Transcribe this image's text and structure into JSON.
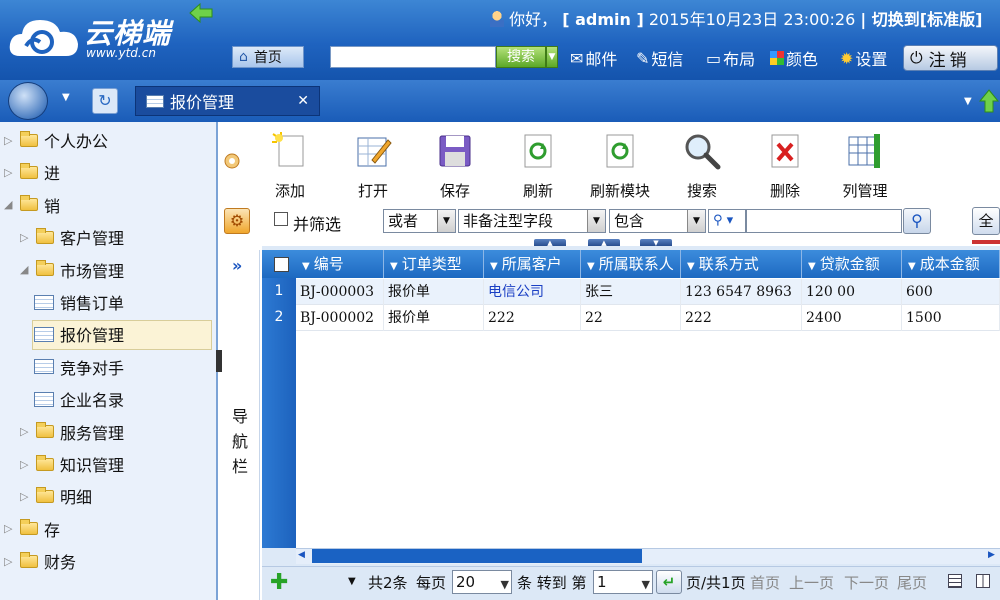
{
  "header": {
    "logo_text": "云梯端",
    "logo_sub": "www.ytd.cn",
    "greeting": "你好，",
    "username": "[ admin ]",
    "datetime": "2015年10月23日  23:00:26",
    "switch_text": "| 切换到[标准版]",
    "home_label": "首页",
    "search_button": "搜索",
    "links": {
      "mail": "邮件",
      "sms": "短信",
      "layout": "布局",
      "color": "颜色",
      "settings": "设置"
    },
    "logout_label": "注销"
  },
  "tabs": [
    {
      "label": "报价管理",
      "active": true
    }
  ],
  "sidebar": {
    "items": [
      {
        "label": "个人办公",
        "level": 0,
        "kind": "folder"
      },
      {
        "label": "进",
        "level": 0,
        "kind": "folder"
      },
      {
        "label": "销",
        "level": 0,
        "kind": "folder-open"
      },
      {
        "label": "客户管理",
        "level": 1,
        "kind": "folder"
      },
      {
        "label": "市场管理",
        "level": 1,
        "kind": "folder-open"
      },
      {
        "label": "销售订单",
        "level": 2,
        "kind": "doc"
      },
      {
        "label": "报价管理",
        "level": 2,
        "kind": "doc",
        "selected": true
      },
      {
        "label": "竞争对手",
        "level": 2,
        "kind": "doc"
      },
      {
        "label": "企业名录",
        "level": 2,
        "kind": "doc"
      },
      {
        "label": "服务管理",
        "level": 1,
        "kind": "folder"
      },
      {
        "label": "知识管理",
        "level": 1,
        "kind": "folder"
      },
      {
        "label": "明细",
        "level": 1,
        "kind": "folder"
      },
      {
        "label": "存",
        "level": 0,
        "kind": "folder"
      },
      {
        "label": "财务",
        "level": 0,
        "kind": "folder"
      }
    ]
  },
  "toolbar": {
    "buttons": [
      {
        "label": "添加",
        "icon": "add-doc-icon"
      },
      {
        "label": "打开",
        "icon": "open-edit-icon"
      },
      {
        "label": "保存",
        "icon": "save-icon"
      },
      {
        "label": "刷新",
        "icon": "refresh-icon"
      },
      {
        "label": "刷新模块",
        "icon": "refresh-module-icon"
      },
      {
        "label": "搜索",
        "icon": "magnifier-icon"
      },
      {
        "label": "删除",
        "icon": "delete-icon"
      },
      {
        "label": "列管理",
        "icon": "column-manage-icon"
      }
    ]
  },
  "filter": {
    "checkbox_label": "并筛选",
    "logic": "或者",
    "field": "非备注型字段",
    "operator": "包含",
    "value": "",
    "all_button": "全"
  },
  "nav_strip": {
    "expand": "»",
    "label": "导航栏"
  },
  "grid": {
    "columns": [
      "编号",
      "订单类型",
      "所属客户",
      "所属联系人",
      "联系方式",
      "贷款金额",
      "成本金额"
    ],
    "rows": [
      {
        "num": "1",
        "cells": [
          "BJ-000003",
          "报价单",
          "电信公司",
          "张三",
          "123 6547 8963",
          "120 00",
          "600"
        ]
      },
      {
        "num": "2",
        "cells": [
          "BJ-000002",
          "报价单",
          "222",
          "22",
          "222",
          "2400",
          "1500"
        ]
      }
    ]
  },
  "pager": {
    "total": "共2条",
    "per_page_label": "每页",
    "per_page": "20",
    "goto_label": "条 转到 第",
    "page": "1",
    "pages_label": "页/共1页",
    "first": "首页",
    "prev": "上一页",
    "next": "下一页",
    "last": "尾页"
  },
  "colors": {
    "header_blue": "#1f63bf",
    "grid_header": "#1d69c1",
    "sidebar_bg": "#eaf1fb",
    "selected_bg": "#fbf3d6",
    "link_blue": "#1a3fc4"
  }
}
